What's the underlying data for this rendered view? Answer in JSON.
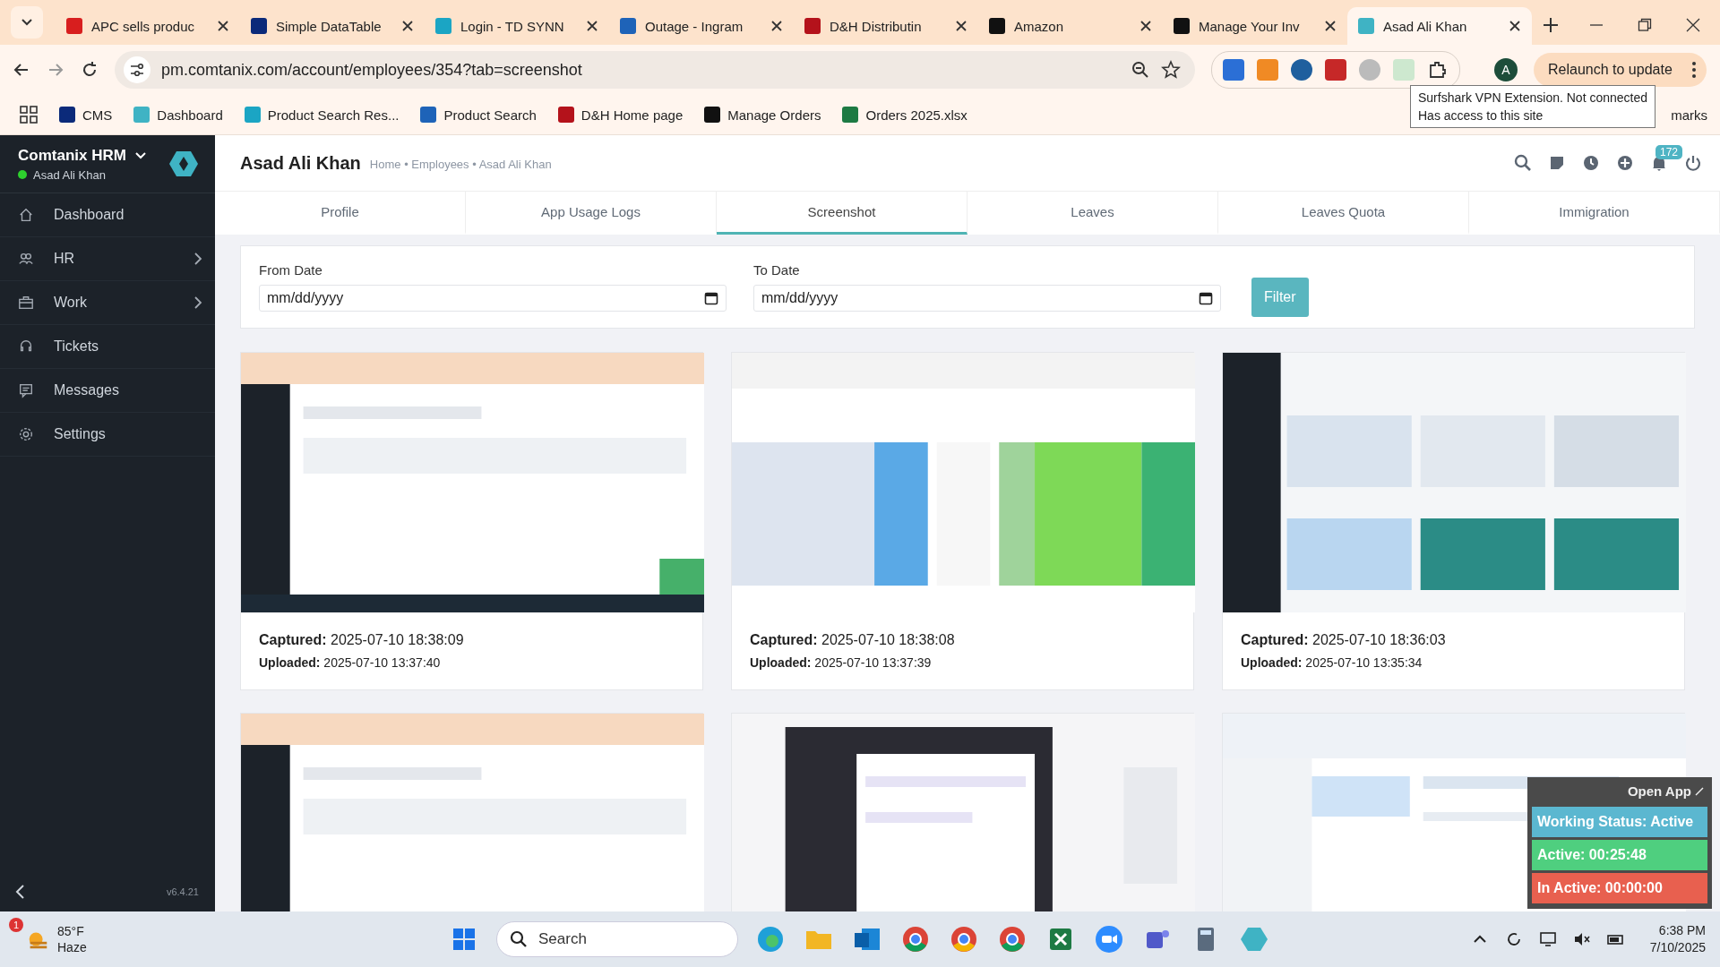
{
  "browser": {
    "tabs": [
      {
        "title": "APC sells produc",
        "selected": false
      },
      {
        "title": "Simple DataTable",
        "selected": false
      },
      {
        "title": "Login - TD SYNN",
        "selected": false
      },
      {
        "title": "Outage - Ingram",
        "selected": false
      },
      {
        "title": "D&H Distributin",
        "selected": false
      },
      {
        "title": "Amazon",
        "selected": false
      },
      {
        "title": "Manage Your Inv",
        "selected": false
      },
      {
        "title": "Asad Ali Khan",
        "selected": true
      }
    ],
    "address": "pm.comtanix.com/account/employees/354?tab=screenshot",
    "profile_initial": "A",
    "relaunch": "Relaunch to update",
    "bookmarks": [
      "CMS",
      "Dashboard",
      "Product Search Res...",
      "Product Search",
      "D&H Home page",
      "Manage Orders",
      "Orders 2025.xlsx"
    ],
    "bookmarks_tail": "marks",
    "tooltip": [
      "Surfshark VPN Extension. Not connected",
      "Has access to this site"
    ]
  },
  "sidebar": {
    "app_name": "Comtanix HRM",
    "user": "Asad Ali Khan",
    "online": true,
    "items": [
      {
        "label": "Dashboard",
        "kind": "home",
        "has_submenu": false
      },
      {
        "label": "HR",
        "kind": "people",
        "has_submenu": true
      },
      {
        "label": "Work",
        "kind": "briefcase",
        "has_submenu": true
      },
      {
        "label": "Tickets",
        "kind": "headset",
        "has_submenu": false
      },
      {
        "label": "Messages",
        "kind": "message",
        "has_submenu": false
      },
      {
        "label": "Settings",
        "kind": "gear",
        "has_submenu": false
      }
    ],
    "version": "v6.4.21"
  },
  "header": {
    "title": "Asad Ali Khan",
    "breadcrumb": "Home • Employees • Asad Ali Khan",
    "notification_count": "172"
  },
  "tabs": [
    {
      "label": "Profile",
      "selected": false
    },
    {
      "label": "App Usage Logs",
      "selected": false
    },
    {
      "label": "Screenshot",
      "selected": true
    },
    {
      "label": "Leaves",
      "selected": false
    },
    {
      "label": "Leaves Quota",
      "selected": false
    },
    {
      "label": "Immigration",
      "selected": false
    }
  ],
  "filter": {
    "from_label": "From Date",
    "from_placeholder": "mm/dd/yyyy",
    "to_label": "To Date",
    "to_placeholder": "mm/dd/yyyy",
    "button": "Filter"
  },
  "screenshots": [
    {
      "kind": "browser",
      "captured_label": "Captured:",
      "captured": "2025-07-10 18:38:09",
      "uploaded_label": "Uploaded:",
      "uploaded": "2025-07-10 13:37:40"
    },
    {
      "kind": "spreadsheet",
      "captured_label": "Captured:",
      "captured": "2025-07-10 18:38:08",
      "uploaded_label": "Uploaded:",
      "uploaded": "2025-07-10 13:37:39"
    },
    {
      "kind": "gallery",
      "captured_label": "Captured:",
      "captured": "2025-07-10 18:36:03",
      "uploaded_label": "Uploaded:",
      "uploaded": "2025-07-10 13:35:34"
    },
    {
      "kind": "browser"
    },
    {
      "kind": "chat"
    },
    {
      "kind": "mail"
    }
  ],
  "widget": {
    "open_app": "Open App",
    "status": "Working Status: Active",
    "active": "Active: 00:25:48",
    "inactive": "In Active: 00:00:00"
  },
  "taskbar": {
    "weather_badge": "1",
    "temperature": "85°F",
    "condition": "Haze",
    "search": "Search",
    "time": "6:38 PM",
    "date": "7/10/2025"
  }
}
